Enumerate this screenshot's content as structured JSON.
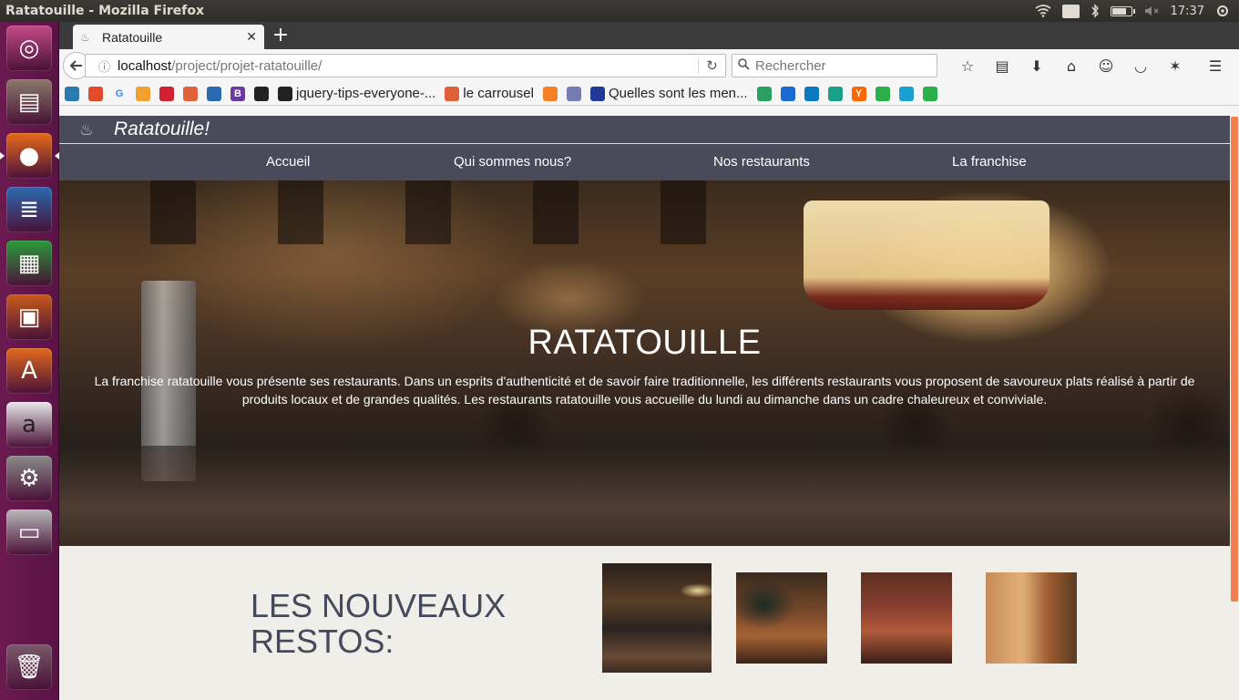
{
  "os": {
    "window_title": "Ratatouille - Mozilla Firefox",
    "keyboard_layout": "Fr",
    "clock": "17:37",
    "battery_level": 0.8
  },
  "launcher": {
    "items": [
      {
        "name": "ubuntu-dash",
        "glyph": "◎",
        "color": "#c44a8a"
      },
      {
        "name": "files",
        "glyph": "▤",
        "color": "#8a7a6a"
      },
      {
        "name": "firefox",
        "glyph": "●",
        "color": "#e66a1a"
      },
      {
        "name": "libreoffice-writer",
        "glyph": "≣",
        "color": "#2a6ab0"
      },
      {
        "name": "libreoffice-calc",
        "glyph": "▦",
        "color": "#2a9a3a"
      },
      {
        "name": "libreoffice-impress",
        "glyph": "▣",
        "color": "#c85a1a"
      },
      {
        "name": "ubuntu-software",
        "glyph": "A",
        "color": "#e2691e"
      },
      {
        "name": "amazon",
        "glyph": "a",
        "color": "#e8e8e8"
      },
      {
        "name": "system-settings",
        "glyph": "⚙",
        "color": "#8a8a8a"
      },
      {
        "name": "disk",
        "glyph": "▭",
        "color": "#b8b8b8"
      },
      {
        "name": "trash",
        "glyph": "🗑",
        "color": "#7a5a6a"
      }
    ]
  },
  "browser": {
    "tab_title": "Ratatouille",
    "url_host": "localhost",
    "url_path": "/project/projet-ratatouille/",
    "search_placeholder": "Rechercher",
    "bookmarks": [
      {
        "label": "",
        "icon": "ca"
      },
      {
        "label": "",
        "icon": "ms"
      },
      {
        "label": "",
        "icon": "G"
      },
      {
        "label": "",
        "icon": "sw"
      },
      {
        "label": "",
        "icon": "po"
      },
      {
        "label": "",
        "icon": "ar"
      },
      {
        "label": "",
        "icon": "wp"
      },
      {
        "label": "",
        "icon": "B"
      },
      {
        "label": "",
        "icon": "gh"
      },
      {
        "label": "jquery-tips-everyone-...",
        "icon": "gh"
      },
      {
        "label": "le carrousel",
        "icon": "ar"
      },
      {
        "label": "",
        "icon": "so"
      },
      {
        "label": "",
        "icon": "php"
      },
      {
        "label": "Quelles sont les men...",
        "icon": "fr"
      },
      {
        "label": "",
        "icon": "dr"
      },
      {
        "label": "",
        "icon": "ed"
      },
      {
        "label": "",
        "icon": "tr"
      },
      {
        "label": "",
        "icon": "gr"
      },
      {
        "label": "",
        "icon": "Y"
      },
      {
        "label": "",
        "icon": "un"
      },
      {
        "label": "",
        "icon": "bl"
      },
      {
        "label": "",
        "icon": "fe"
      }
    ]
  },
  "site": {
    "brand": "Ratatouille!",
    "nav": [
      "Accueil",
      "Qui sommes nous?",
      "Nos restaurants",
      "La franchise"
    ],
    "hero_title": "RATATOUILLE",
    "hero_text": "La franchise ratatouille vous présente ses restaurants. Dans un esprits d'authenticité et de savoir faire traditionnelle, les différents restaurants vous proposent de savoureux plats réalisé à partir de produits locaux et de grandes qualités. Les restaurants ratatouille vous accueille du lundi au dimanche dans un cadre chaleureux et conviviale.",
    "news_heading_line1": "LES NOUVEAUX",
    "news_heading_line2": "RESTOS:"
  }
}
